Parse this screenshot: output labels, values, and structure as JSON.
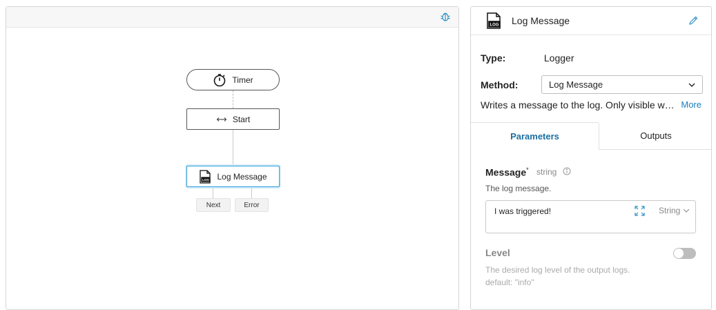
{
  "canvas": {
    "nodes": {
      "timer": {
        "label": "Timer",
        "icon": "stopwatch-icon"
      },
      "start": {
        "label": "Start",
        "icon": "arrows-horizontal-icon"
      },
      "log": {
        "label": "Log Message",
        "icon": "log-file-icon"
      }
    },
    "ports": {
      "next": "Next",
      "error": "Error"
    },
    "toolbar": {
      "debug_icon": "bug-icon"
    }
  },
  "panel": {
    "title": "Log Message",
    "type_label": "Type:",
    "type_value": "Logger",
    "method_label": "Method:",
    "method_value": "Log Message",
    "description": "Writes a message to the log. Only visible when running in debug mode.",
    "more_label": "More",
    "tabs": {
      "parameters": "Parameters",
      "outputs": "Outputs"
    },
    "message": {
      "label": "Message",
      "required_mark": "*",
      "type": "string",
      "help": "The log message.",
      "value": "I was triggered!",
      "type_dropdown": "String"
    },
    "level": {
      "label": "Level",
      "help": "The desired log level of the output logs.",
      "default_text": "default: \"info\"",
      "enabled": false
    }
  },
  "colors": {
    "accent": "#1a7dbe",
    "selected_node_border": "#2d9cdb"
  }
}
